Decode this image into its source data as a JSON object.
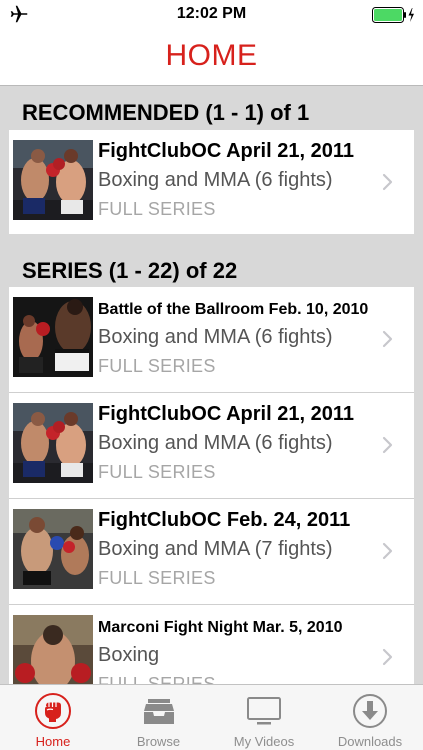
{
  "status_bar": {
    "time": "12:02 PM"
  },
  "nav": {
    "title": "HOME"
  },
  "recommended": {
    "header": "RECOMMENDED (1 - 1) of 1",
    "items": [
      {
        "title": "FightClubOC April 21, 2011",
        "subtitle": "Boxing and MMA (6 fights)",
        "tag": "FULL SERIES",
        "thumb_icon": "boxing-photo-fightclub-april"
      }
    ]
  },
  "series": {
    "header": "SERIES (1 - 22) of 22",
    "items": [
      {
        "title": "Battle of the Ballroom Feb. 10, 2010",
        "subtitle": "Boxing and MMA (6 fights)",
        "tag": "FULL SERIES",
        "thumb_icon": "boxing-photo-ballroom"
      },
      {
        "title": "FightClubOC April 21, 2011",
        "subtitle": "Boxing and MMA (6 fights)",
        "tag": "FULL SERIES",
        "thumb_icon": "boxing-photo-fightclub-april"
      },
      {
        "title": "FightClubOC Feb. 24, 2011",
        "subtitle": "Boxing and MMA (7 fights)",
        "tag": "FULL SERIES",
        "thumb_icon": "boxing-photo-fightclub-feb"
      },
      {
        "title": "Marconi Fight Night Mar. 5, 2010",
        "subtitle": "Boxing",
        "tag": "FULL SERIES",
        "thumb_icon": "boxing-photo-marconi"
      }
    ]
  },
  "tabbar": {
    "items": [
      {
        "label": "Home",
        "icon": "fist-icon",
        "active": true
      },
      {
        "label": "Browse",
        "icon": "inbox-tray-icon",
        "active": false
      },
      {
        "label": "My Videos",
        "icon": "monitor-icon",
        "active": false
      },
      {
        "label": "Downloads",
        "icon": "download-arrow-icon",
        "active": false
      }
    ]
  },
  "colors": {
    "accent": "#d7211c",
    "section_bg": "#d8d8d8",
    "tag_gray": "#a6a6a6"
  }
}
